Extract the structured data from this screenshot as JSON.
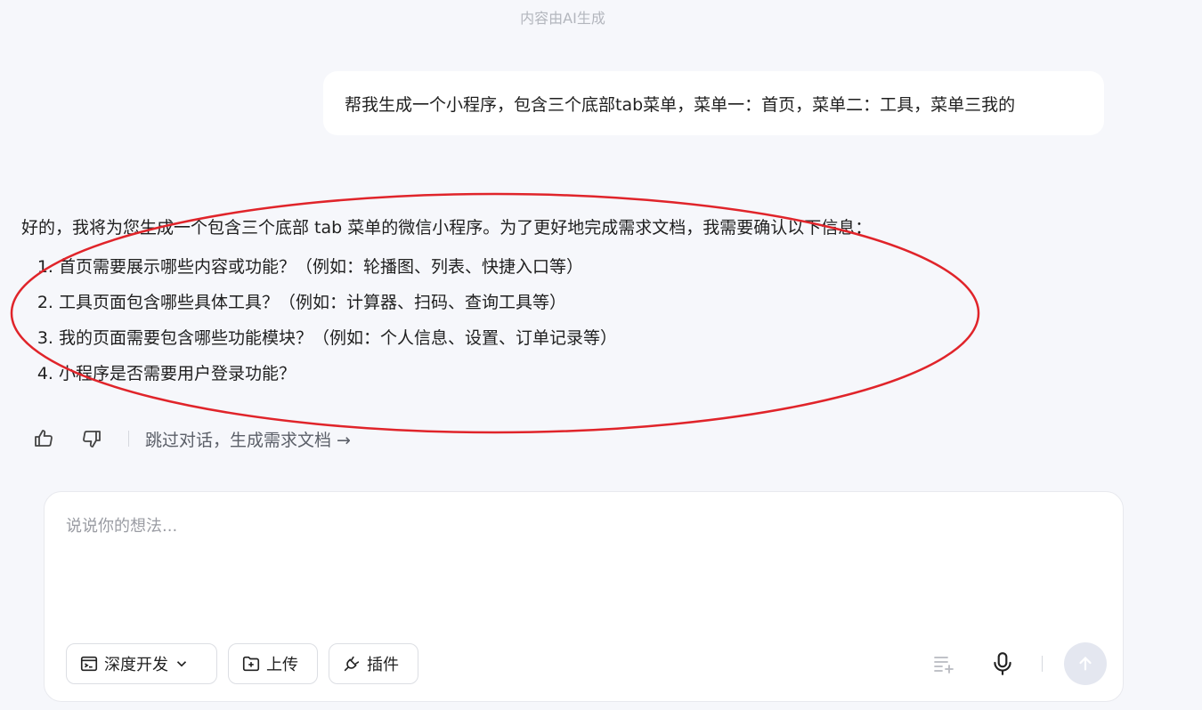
{
  "header": {
    "ai_note": "内容由AI生成"
  },
  "user_message": {
    "text": "帮我生成一个小程序，包含三个底部tab菜单，菜单一：首页，菜单二：工具，菜单三我的"
  },
  "assistant_message": {
    "intro": "好的，我将为您生成一个包含三个底部 tab 菜单的微信小程序。为了更好地完成需求文档，我需要确认以下信息：",
    "questions": [
      "首页需要展示哪些内容或功能？（例如：轮播图、列表、快捷入口等）",
      "工具页面包含哪些具体工具？（例如：计算器、扫码、查询工具等）",
      "我的页面需要包含哪些功能模块？（例如：个人信息、设置、订单记录等）",
      "小程序是否需要用户登录功能？"
    ],
    "highlight_color": "#e0242a"
  },
  "actions": {
    "like_icon": "thumbs-up-icon",
    "dislike_icon": "thumbs-down-icon",
    "skip_label": "跳过对话，生成需求文档 →"
  },
  "composer": {
    "placeholder": "说说你的想法...",
    "deep_dev_label": "深度开发",
    "upload_label": "上传",
    "plugin_label": "插件",
    "send_disabled_color": "#e4e7f0"
  }
}
